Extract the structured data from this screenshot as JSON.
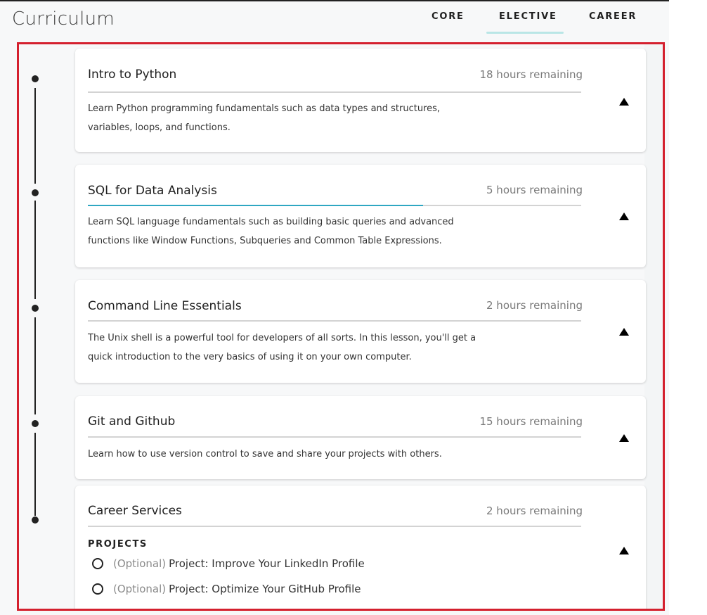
{
  "header": {
    "title": "Curriculum",
    "tabs": [
      {
        "label": "CORE",
        "active": false
      },
      {
        "label": "ELECTIVE",
        "active": true
      },
      {
        "label": "CAREER",
        "active": false
      }
    ],
    "active_tab_color": "#b9e6e6"
  },
  "highlight_color": "#d4202e",
  "courses": [
    {
      "title": "Intro to Python",
      "remaining": "18 hours remaining",
      "progress": 0,
      "description": "Learn Python programming fundamentals such as data types and structures, variables, loops, and functions.",
      "expanded": true
    },
    {
      "title": "SQL for Data Analysis",
      "remaining": "5 hours remaining",
      "progress": 0.68,
      "progress_color": "#2fa7c2",
      "description": "Learn SQL language fundamentals such as building basic queries and advanced functions like Window Functions, Subqueries and Common Table Expressions.",
      "expanded": true
    },
    {
      "title": "Command Line Essentials",
      "remaining": "2 hours remaining",
      "progress": 0,
      "description": "The Unix shell is a powerful tool for developers of all sorts. In this lesson, you'll get a quick introduction to the very basics of using it on your own computer.",
      "expanded": true
    },
    {
      "title": "Git and Github",
      "remaining": "15 hours remaining",
      "progress": 0,
      "description": "Learn how to use version control to save and share your projects with others.",
      "expanded": true
    },
    {
      "title": "Career Services",
      "remaining": "2 hours remaining",
      "progress": 0,
      "projects_label": "PROJECTS",
      "projects": [
        {
          "optional": "(Optional)",
          "name": "Project: Improve Your LinkedIn Profile",
          "completed": false
        },
        {
          "optional": "(Optional)",
          "name": "Project: Optimize Your GitHub Profile",
          "completed": false
        }
      ],
      "expanded": true
    }
  ]
}
